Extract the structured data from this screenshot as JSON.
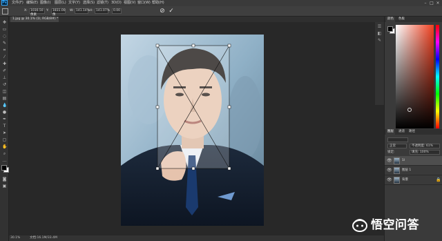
{
  "menubar": {
    "app_logo": "Ps",
    "menu_items": [
      "文件(F)",
      "编辑(E)",
      "图像(I)",
      "图层(L)",
      "文字(Y)",
      "选择(S)",
      "滤镜(T)",
      "3D(D)",
      "视图(V)",
      "窗口(W)",
      "帮助(H)"
    ],
    "window_controls": [
      "–",
      "□",
      "×"
    ]
  },
  "options_bar": {
    "x_label": "X:",
    "x_value": "1030.50 像素",
    "y_label": "Y:",
    "y_value": "1831.00 像",
    "w_label": "W:",
    "w_value": "141.14%",
    "h_label": "H:",
    "h_value": "141.07%",
    "angle_value": "0.00",
    "cancel_glyph": "⊘",
    "commit_glyph": "✓"
  },
  "document_tab": {
    "label": "1.jpg @ 30.1% (1l, RGB/8#) *"
  },
  "status_bar": {
    "zoom": "30.1%",
    "doc_info": "文档:16.1M/33.4M"
  },
  "right_panel": {
    "top_tabs": [
      "颜色",
      "色板"
    ],
    "layers_tabs": [
      "图层",
      "通道",
      "路径"
    ],
    "blend_mode": "正常",
    "opacity": "不透明度: 61%",
    "lock_row": "锁定:",
    "fill": "填充: 100%",
    "layers": [
      {
        "name": "1l",
        "selected": true
      },
      {
        "name": "图层 1",
        "selected": false
      },
      {
        "name": "背景",
        "selected": false
      }
    ]
  },
  "watermark": {
    "text": "悟空问答"
  },
  "colors": {
    "accent": "#31a8ff",
    "panel_bg": "#3a3a3a",
    "canvas_bg": "#282828"
  }
}
